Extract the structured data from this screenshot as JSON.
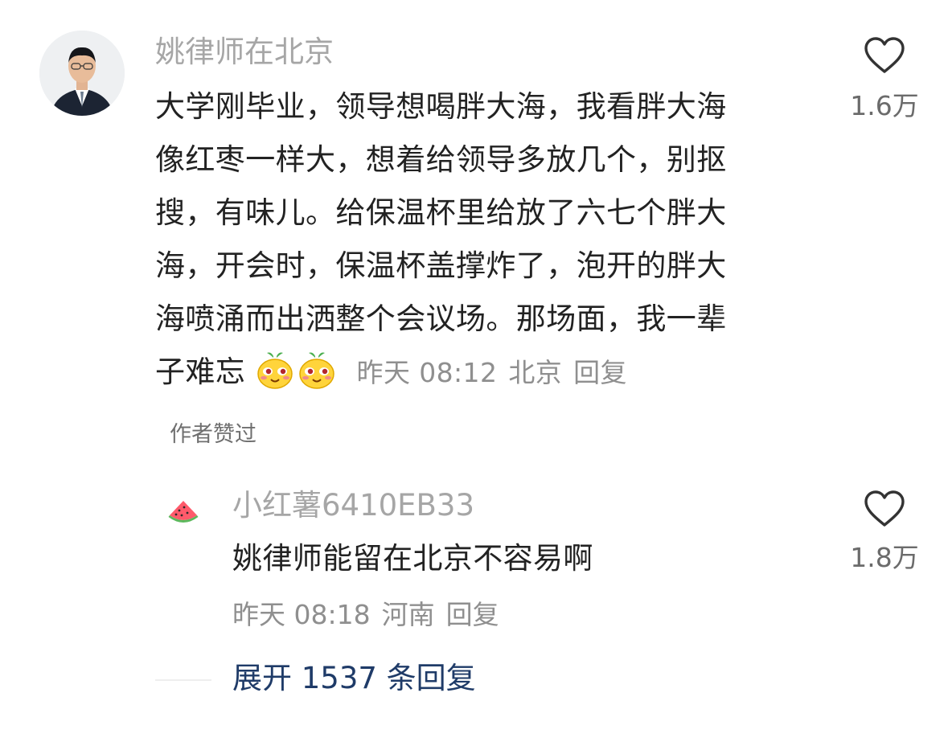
{
  "main_comment": {
    "username": "姚律师在北京",
    "text_lines": [
      "大学刚毕业，领导想喝胖大海，我看胖大海",
      "像红枣一样大，想着给领导多放几个，别抠",
      "搜，有味儿。给保温杯里给放了六七个胖大",
      "海，开会时，保温杯盖撑炸了，泡开的胖大",
      "海喷涌而出洒整个会议场。那场面，我一辈"
    ],
    "last_line_text": "子难忘",
    "emoji_icons": [
      "yellow-face-emoji-icon",
      "yellow-face-emoji-icon"
    ],
    "time": "昨天 08:12",
    "location": "北京",
    "reply_label": "回复",
    "like_count": "1.6万",
    "author_liked": "作者赞过"
  },
  "reply_comment": {
    "username": "小红薯6410EB33",
    "avatar_icon": "watermelon-icon",
    "text": "姚律师能留在北京不容易啊",
    "time": "昨天 08:18",
    "location": "河南",
    "reply_label": "回复",
    "like_count": "1.8万"
  },
  "expand": {
    "label": "展开 1537 条回复"
  },
  "colors": {
    "username": "#a6a6a6",
    "text": "#222222",
    "meta": "#8f8f8f",
    "expand": "#1f3b68"
  }
}
